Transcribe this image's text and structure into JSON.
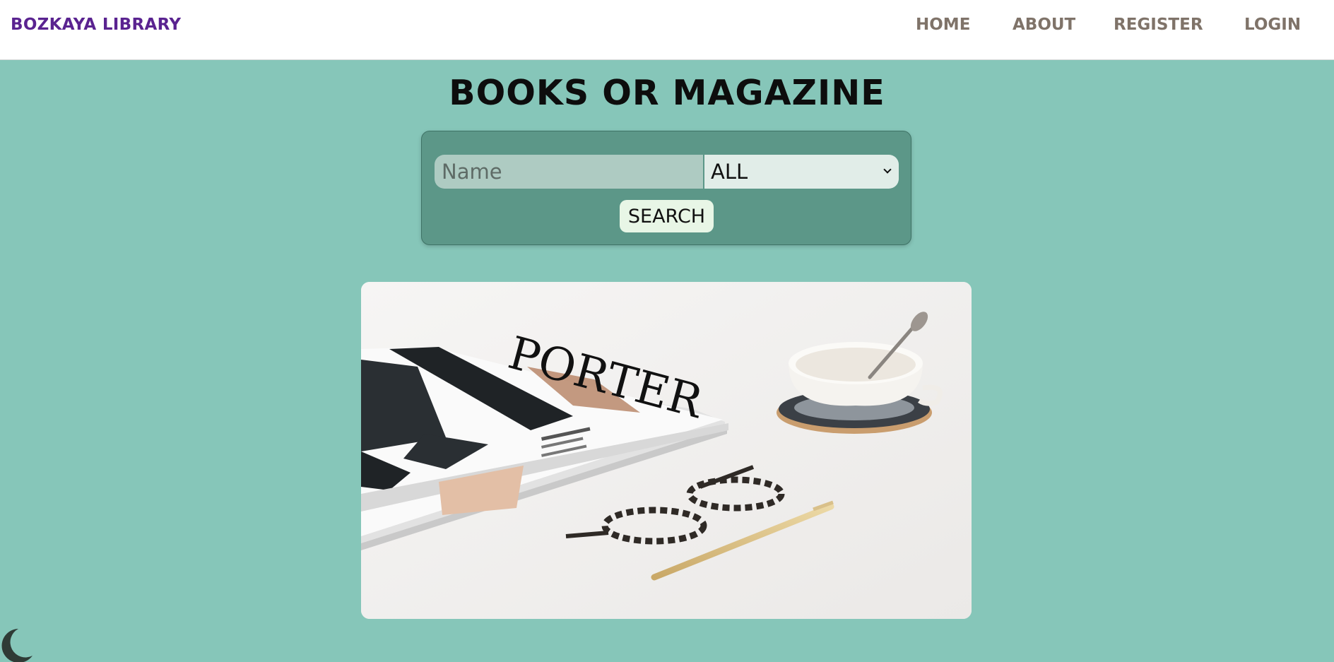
{
  "header": {
    "brand": "BOZKAYA LIBRARY",
    "nav": {
      "home": "HOME",
      "about": "ABOUT",
      "register": "REGISTER",
      "login": "LOGIN"
    }
  },
  "main": {
    "title": "BOOKS OR MAGAZINE",
    "search": {
      "name_placeholder": "Name",
      "name_value": "",
      "category_selected": "ALL",
      "button_label": "SEARCH"
    },
    "hero_image": {
      "magazine_text": "PORTER"
    }
  },
  "theme_toggle": {
    "icon": "moon-icon"
  },
  "colors": {
    "page_background": "#86c6b9",
    "brand": "#5a2390",
    "nav_text": "#7f7369",
    "panel": "#5c9788",
    "button": "#e8f6e6"
  }
}
